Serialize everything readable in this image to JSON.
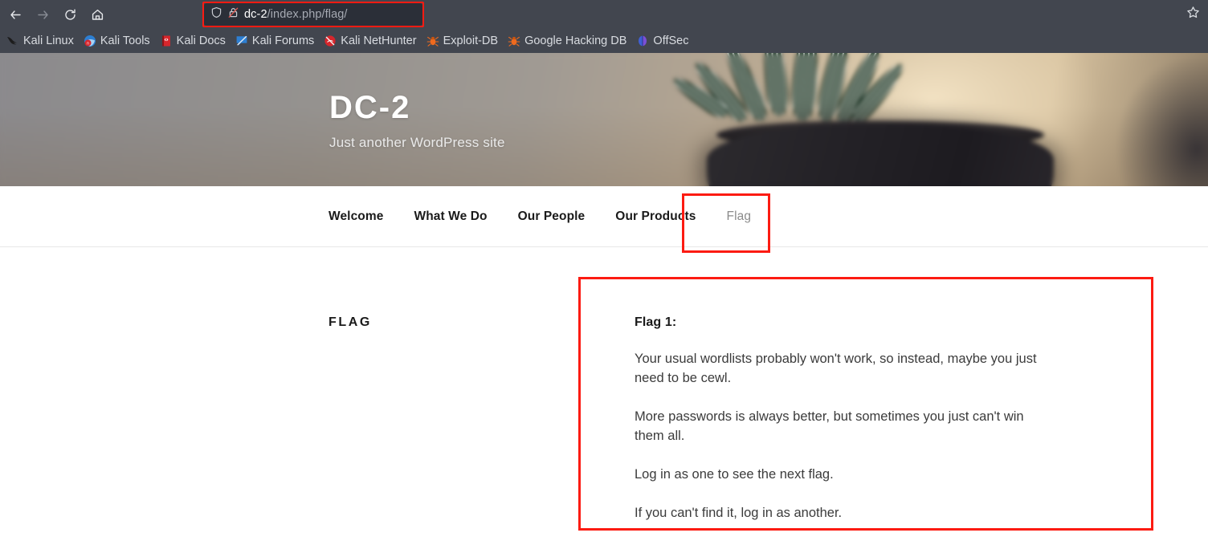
{
  "browser": {
    "nav": {
      "back_icon": "arrow-left-icon",
      "forward_icon": "arrow-right-icon",
      "reload_icon": "reload-icon",
      "home_icon": "home-icon"
    },
    "urlbar": {
      "shield_icon": "shield-icon",
      "lock_icon": "lock-crossed-out-icon",
      "host": "dc-2",
      "path": "/index.php/flag/",
      "full_url": "dc-2/index.php/flag/",
      "highlight_color": "#fc1b12"
    },
    "bookmark_star_icon": "star-outline-icon",
    "chrome_background": "#42464f",
    "bookmarks": [
      {
        "label": "Kali Linux",
        "icon": "kali-dragon-icon"
      },
      {
        "label": "Kali Tools",
        "icon": "kali-tools-icon"
      },
      {
        "label": "Kali Docs",
        "icon": "kali-docs-book-icon"
      },
      {
        "label": "Kali Forums",
        "icon": "kali-forums-icon"
      },
      {
        "label": "Kali NetHunter",
        "icon": "kali-nethunter-icon"
      },
      {
        "label": "Exploit-DB",
        "icon": "exploit-db-bug-icon"
      },
      {
        "label": "Google Hacking DB",
        "icon": "google-hacking-db-bug-icon"
      },
      {
        "label": "OffSec",
        "icon": "offsec-icon"
      }
    ]
  },
  "site": {
    "title": "DC-2",
    "tagline": "Just another WordPress site",
    "hero_image_description": "blurred photo of a zebra haworthia succulent in a dark matte pot on a warm wooden surface",
    "nav": [
      {
        "label": "Welcome",
        "current": false
      },
      {
        "label": "What We Do",
        "current": false
      },
      {
        "label": "Our People",
        "current": false
      },
      {
        "label": "Our Products",
        "current": false
      },
      {
        "label": "Flag",
        "current": true
      }
    ]
  },
  "content": {
    "page_title": "FLAG",
    "flag_heading": "Flag 1:",
    "paragraphs": [
      "Your usual wordlists probably won't work, so instead, maybe you just need to be cewl.",
      "More passwords is always better, but sometimes you just can't win them all.",
      "Log in as one to see the next flag.",
      "If you can't find it, log in as another."
    ]
  },
  "annotations": {
    "color": "#fc1b12",
    "boxes": [
      "url-bar",
      "flag-nav-item",
      "flag-content-body"
    ]
  }
}
